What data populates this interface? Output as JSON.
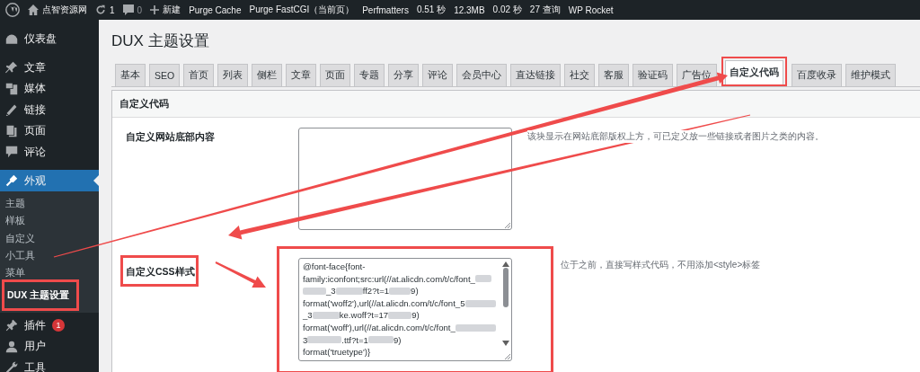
{
  "admin_bar": {
    "site": "点智资源网",
    "updates": "1",
    "comments": "0",
    "new": "新建",
    "links": [
      "Purge Cache",
      "Purge FastCGI（当前页）",
      "Perfmatters"
    ],
    "stats": [
      "0.51 秒",
      "12.3MB",
      "0.02 秒",
      "27 查询"
    ],
    "plugin": "WP Rocket"
  },
  "sidebar": {
    "items": [
      {
        "label": "仪表盘",
        "selected": false
      },
      {
        "label": "文章",
        "selected": false
      },
      {
        "label": "媒体",
        "selected": false
      },
      {
        "label": "链接",
        "selected": false
      },
      {
        "label": "页面",
        "selected": false
      },
      {
        "label": "评论",
        "selected": false
      },
      {
        "label": "外观",
        "selected": true,
        "children": [
          {
            "label": "主题",
            "selected": false,
            "highlighted": false
          },
          {
            "label": "样板",
            "selected": false,
            "highlighted": false
          },
          {
            "label": "自定义",
            "selected": false,
            "highlighted": false
          },
          {
            "label": "小工具",
            "selected": false,
            "highlighted": false
          },
          {
            "label": "菜单",
            "selected": false,
            "highlighted": false
          },
          {
            "label": "DUX 主题设置",
            "selected": true,
            "highlighted": true
          }
        ]
      },
      {
        "label": "插件",
        "selected": false,
        "badge": "1"
      },
      {
        "label": "用户",
        "selected": false
      },
      {
        "label": "工具",
        "selected": false
      }
    ]
  },
  "page_title": "DUX 主题设置",
  "tabs": [
    {
      "label": "基本",
      "selected": false,
      "highlighted": false
    },
    {
      "label": "SEO",
      "selected": false,
      "highlighted": false
    },
    {
      "label": "首页",
      "selected": false,
      "highlighted": false
    },
    {
      "label": "列表",
      "selected": false,
      "highlighted": false
    },
    {
      "label": "侧栏",
      "selected": false,
      "highlighted": false
    },
    {
      "label": "文章",
      "selected": false,
      "highlighted": false
    },
    {
      "label": "页面",
      "selected": false,
      "highlighted": false
    },
    {
      "label": "专题",
      "selected": false,
      "highlighted": false
    },
    {
      "label": "分享",
      "selected": false,
      "highlighted": false
    },
    {
      "label": "评论",
      "selected": false,
      "highlighted": false
    },
    {
      "label": "会员中心",
      "selected": false,
      "highlighted": false
    },
    {
      "label": "直达链接",
      "selected": false,
      "highlighted": false
    },
    {
      "label": "社交",
      "selected": false,
      "highlighted": false
    },
    {
      "label": "客服",
      "selected": false,
      "highlighted": false
    },
    {
      "label": "验证码",
      "selected": false,
      "highlighted": false
    },
    {
      "label": "广告位",
      "selected": false,
      "highlighted": false
    },
    {
      "label": "自定义代码",
      "selected": true,
      "highlighted": true
    },
    {
      "label": "百度收录",
      "selected": false,
      "highlighted": false
    },
    {
      "label": "维护模式",
      "selected": false,
      "highlighted": false
    }
  ],
  "panel": {
    "heading": "自定义代码",
    "fields": [
      {
        "label": "自定义网站底部内容",
        "highlighted": false,
        "description": "该块显示在网站底部版权上方，可已定义放一些链接或者图片之类的内容。",
        "scrollbar": false
      },
      {
        "label": "自定义CSS样式",
        "highlighted": true,
        "description": "位于之前，直接写样式代码，不用添加<style>标签",
        "scrollbar": true,
        "lines": [
          [
            {
              "text": "@font-face{font-"
            }
          ],
          [
            {
              "text": "family:iconfont;src:url(//at.alicdn.com/t/c/font_"
            },
            {
              "kind": "blur"
            }
          ],
          [
            {
              "kind": "blur"
            },
            {
              "text": "_3"
            },
            {
              "kind": "blur"
            },
            {
              "text": "ff2?t=1"
            },
            {
              "kind": "blur"
            },
            {
              "text": "9)"
            }
          ],
          [
            {
              "text": "format('woff2'),url(//at.alicdn.com/t/c/font_5"
            },
            {
              "kind": "blur"
            }
          ],
          [
            {
              "text": "_3"
            },
            {
              "kind": "blur"
            },
            {
              "text": "ke.woff?t=17"
            },
            {
              "kind": "blur"
            },
            {
              "text": "9)"
            }
          ],
          [
            {
              "text": "format('woff'),url(//at.alicdn.com/t/c/font_"
            },
            {
              "kind": "blur"
            }
          ],
          [
            {
              "text": "3"
            },
            {
              "kind": "blur"
            },
            {
              "text": ".ttf?t=1"
            },
            {
              "kind": "blur"
            },
            {
              "text": "9)"
            }
          ],
          [
            {
              "text": "format('truetype')}"
            }
          ]
        ]
      }
    ]
  }
}
